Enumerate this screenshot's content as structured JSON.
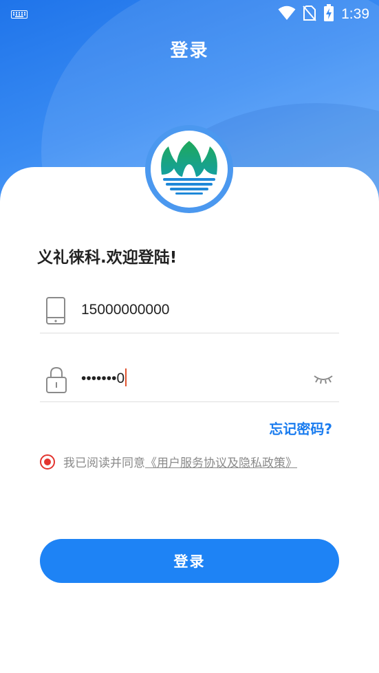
{
  "status_bar": {
    "time": "1:39"
  },
  "header": {
    "title": "登录"
  },
  "welcome_text": "义礼徕科.欢迎登陆!",
  "phone_field": {
    "value": "15000000000"
  },
  "password_field": {
    "value": "•••••••0"
  },
  "forgot_password": "忘记密码?",
  "agreement": {
    "prefix": "我已阅读并同意",
    "link": "《用户服务协议及隐私政策》"
  },
  "login_button": "登录",
  "colors": {
    "accent": "#1e83f5",
    "radio": "#e3342f",
    "header_gradient_start": "#1f74ea"
  },
  "icons": [
    "keyboard-icon",
    "wifi-icon",
    "no-sim-icon",
    "battery-charging-icon",
    "phone-icon",
    "lock-icon",
    "eye-closed-icon",
    "logo-icon"
  ]
}
